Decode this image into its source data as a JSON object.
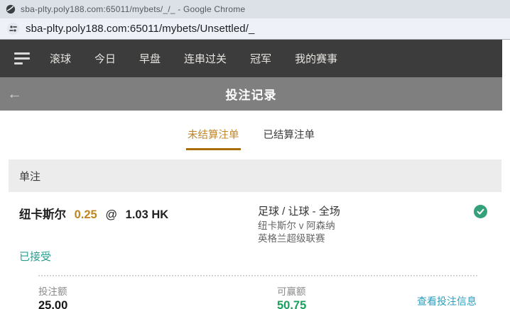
{
  "browser": {
    "window_title": "sba-plty.poly188.com:65011/mybets/_/_ - Google Chrome",
    "url": "sba-plty.poly188.com:65011/mybets/Unsettled/_"
  },
  "nav": {
    "items": [
      {
        "label": "滚球"
      },
      {
        "label": "今日"
      },
      {
        "label": "早盘"
      },
      {
        "label": "连串过关"
      },
      {
        "label": "冠军"
      },
      {
        "label": "我的赛事"
      }
    ]
  },
  "header": {
    "back_icon": "←",
    "title": "投注记录"
  },
  "tabs": {
    "unsettled": "未结算注单",
    "settled": "已结算注单"
  },
  "section": {
    "label": "单注"
  },
  "bet": {
    "selection": "纽卡斯尔",
    "handicap": "0.25",
    "at_symbol": "@",
    "odds": "1.03 HK",
    "market": "足球 / 让球 - 全场",
    "match": "纽卡斯尔 v 阿森纳",
    "league": "英格兰超级联赛",
    "status": "已接受",
    "stake_label": "投注额",
    "stake_value": "25.00",
    "win_label": "可赢额",
    "win_value": "50.75",
    "details_link": "查看投注信息"
  },
  "colors": {
    "accent_amber": "#c0862a",
    "tab_underline": "#a96d08",
    "status_teal": "#2b9c90",
    "win_green": "#18a05c",
    "link_blue": "#2d9fc0",
    "check_green": "#35a17b",
    "navbar_bg": "#3c3c3c",
    "header_bg": "#7f7f7f"
  }
}
